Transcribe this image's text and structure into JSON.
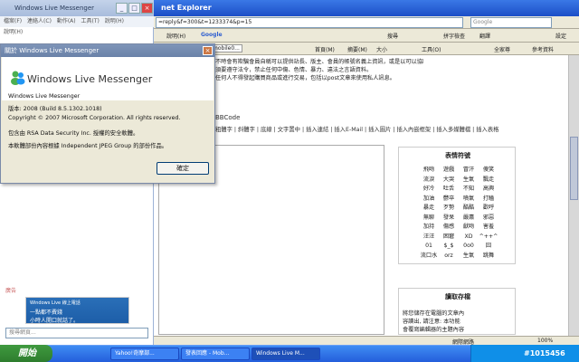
{
  "ie": {
    "title": "net Explorer",
    "address": "=reply&f=300&t=1233374&p=15",
    "search_placeholder": "Google",
    "toolbar1": [
      "說明(H)",
      "Google",
      "搜尋",
      "拼字檢查",
      "翻譯",
      "設定"
    ],
    "toolbar2": [
      "mobile0...",
      "首頁(M)",
      "摘要(M)",
      "大小",
      "工具(O)",
      "全家尊",
      "參考資料"
    ],
    "status_left": "",
    "status_right": "網際網路",
    "zoom": "100%"
  },
  "notice": [
    "不時會有欺騙會員自稱可以提供站長、版主、會員的帳號名義上資訊，或是以可以協助大幅提升、修改個人資料為藉口取得其他會員的帳號資料。",
    "須要遵守法令，禁止任何中傷、色情、暴力、違法之言語資料。",
    "任何人不得發起購買商品或進行交易，包括以post文章來使用私人訊息。"
  ],
  "msn": {
    "title": "Windows Live Messenger",
    "menu": "檔案(F) 連絡人(C) 動作(A) 工具(T) 說明(H)",
    "row": "說明(H)",
    "ad_label": "廣告",
    "ad_line1": "Windows Live 線上電話",
    "ad_line2": "一點都不費錢",
    "ad_line3": "小時人開口就話了。",
    "search_placeholder": "搜尋網頁..."
  },
  "dialog": {
    "title": "關於 Windows Live Messenger",
    "logo": "Windows Live Messenger",
    "product": "Windows Live Messenger",
    "version": "版本: 2008 (Build 8.5.1302.1018)",
    "copyright": "Copyright © 2007 Microsoft Corporation.  All rights reserved.",
    "rsa": "包含由 RSA Data Security Inc. 授權的安全軟體。",
    "jpeg": "本軟體部份內容根據 Independent JPEG Group 的部份作品。",
    "ok": "確定"
  },
  "editor": {
    "bbcode_title": "BBCode",
    "tools": "粗體字 | 斜體字 | 底線 | 文字置中 | 插入連結 | 插入E-Mail | 插入圖片 | 插入內嵌框架 | 插入多媒體檔 | 插入表格"
  },
  "emoticons": {
    "title": "表情符號",
    "items": [
      "飛吻",
      "遊戲",
      "冒汗",
      "傻笑",
      "流淚",
      "大哭",
      "生氣",
      "飄走",
      "好冷",
      "吐舌",
      "不知",
      "高興",
      "加油",
      "鬱卒",
      "噴氣",
      "打瞌",
      "暴走",
      "歹勢",
      "酷酷",
      "歡呼",
      "無聊",
      "發呆",
      "嚴肅",
      "邪惡",
      "加持",
      "傷感",
      "獻吻",
      "害羞",
      "汪汪",
      "困窘",
      "XD",
      "^++^",
      "01",
      "$_$",
      "0o0",
      "囧",
      "流口水",
      "orz",
      "生氣",
      "跳舞"
    ]
  },
  "read": {
    "title": "讀取存檔",
    "lines": [
      "將您儲存在電腦的文章內",
      "容讀出, 請注意: 本功能",
      "會覆寫編輯器的主題內容"
    ]
  },
  "taskbar": {
    "start": "開始",
    "tasks": [
      "Yahoo!奇摩部...",
      "發表回應 - Mob...",
      "Windows Live M..."
    ],
    "clock": "#1015456"
  }
}
